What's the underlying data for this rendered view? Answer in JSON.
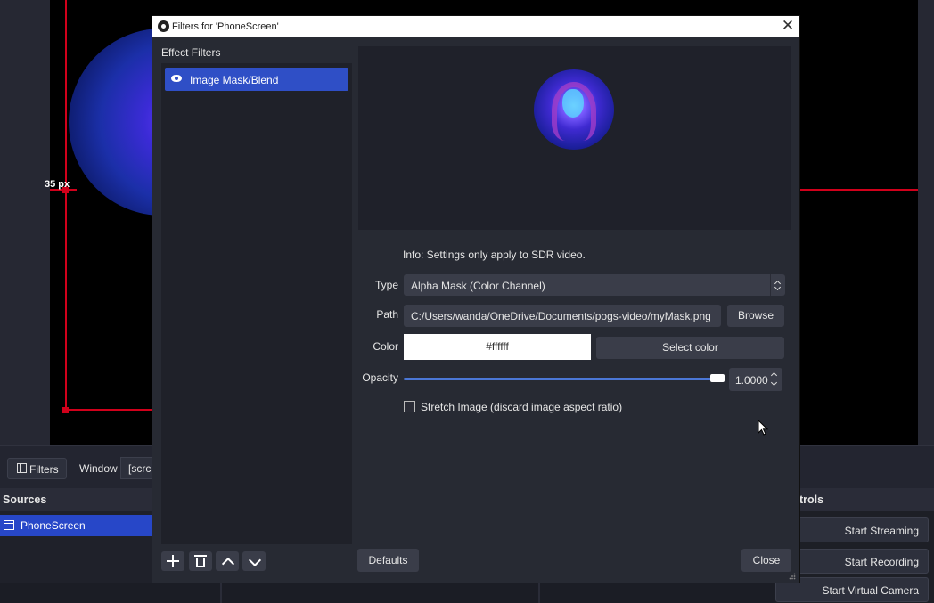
{
  "background": {
    "measure_label": "35 px",
    "toolbar": {
      "filters_label": "Filters",
      "window_label": "Window",
      "window_value": "[scrcp"
    },
    "sources": {
      "header": "Sources",
      "items": [
        {
          "label": "PhoneScreen"
        }
      ]
    },
    "controls": {
      "header": "trols",
      "buttons": [
        "Start Streaming",
        "Start Recording",
        "Start Virtual Camera"
      ]
    }
  },
  "dialog": {
    "title": "Filters for 'PhoneScreen'",
    "close_glyph": "✕",
    "effect_filters_label": "Effect Filters",
    "filters": [
      {
        "label": "Image Mask/Blend",
        "visible": true
      }
    ],
    "info": "Info: Settings only apply to SDR video.",
    "type": {
      "label": "Type",
      "value": "Alpha Mask (Color Channel)"
    },
    "path": {
      "label": "Path",
      "value": "C:/Users/wanda/OneDrive/Documents/pogs-video/myMask.png",
      "browse_label": "Browse"
    },
    "color": {
      "label": "Color",
      "value": "#ffffff",
      "select_label": "Select color"
    },
    "opacity": {
      "label": "Opacity",
      "value": "1.0000",
      "fraction": 1.0
    },
    "stretch": {
      "label": "Stretch Image (discard image aspect ratio)",
      "checked": false
    },
    "defaults_label": "Defaults",
    "close_label": "Close"
  },
  "colors": {
    "accent": "#2f4fc6",
    "guide_red": "#d1001b",
    "dialog_bg": "#272a33"
  }
}
